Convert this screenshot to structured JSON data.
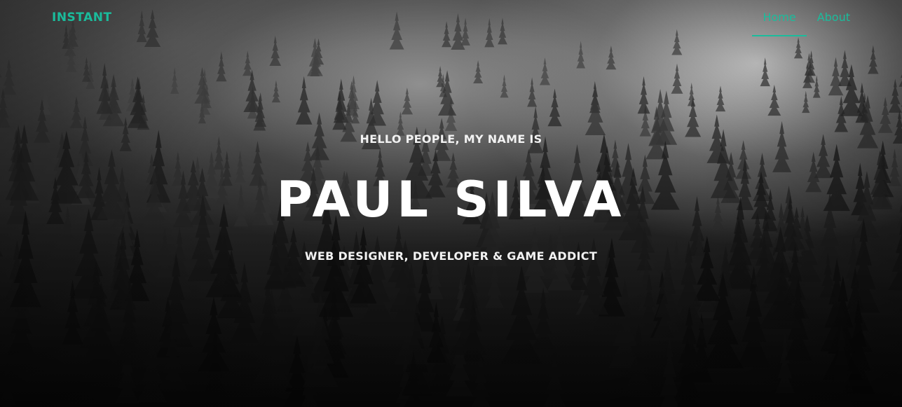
{
  "nav": {
    "brand": "INSTANT",
    "links": [
      {
        "label": "Home",
        "active": true
      },
      {
        "label": "About",
        "active": false
      }
    ]
  },
  "hero": {
    "lead_in": "HELLO PEOPLE, MY NAME IS",
    "heading": "PAUL SILVA",
    "subheading": "WEB DESIGNER, DEVELOPER & GAME ADDICT"
  },
  "colors": {
    "accent": "#1abc9c",
    "text": "#ffffff"
  }
}
